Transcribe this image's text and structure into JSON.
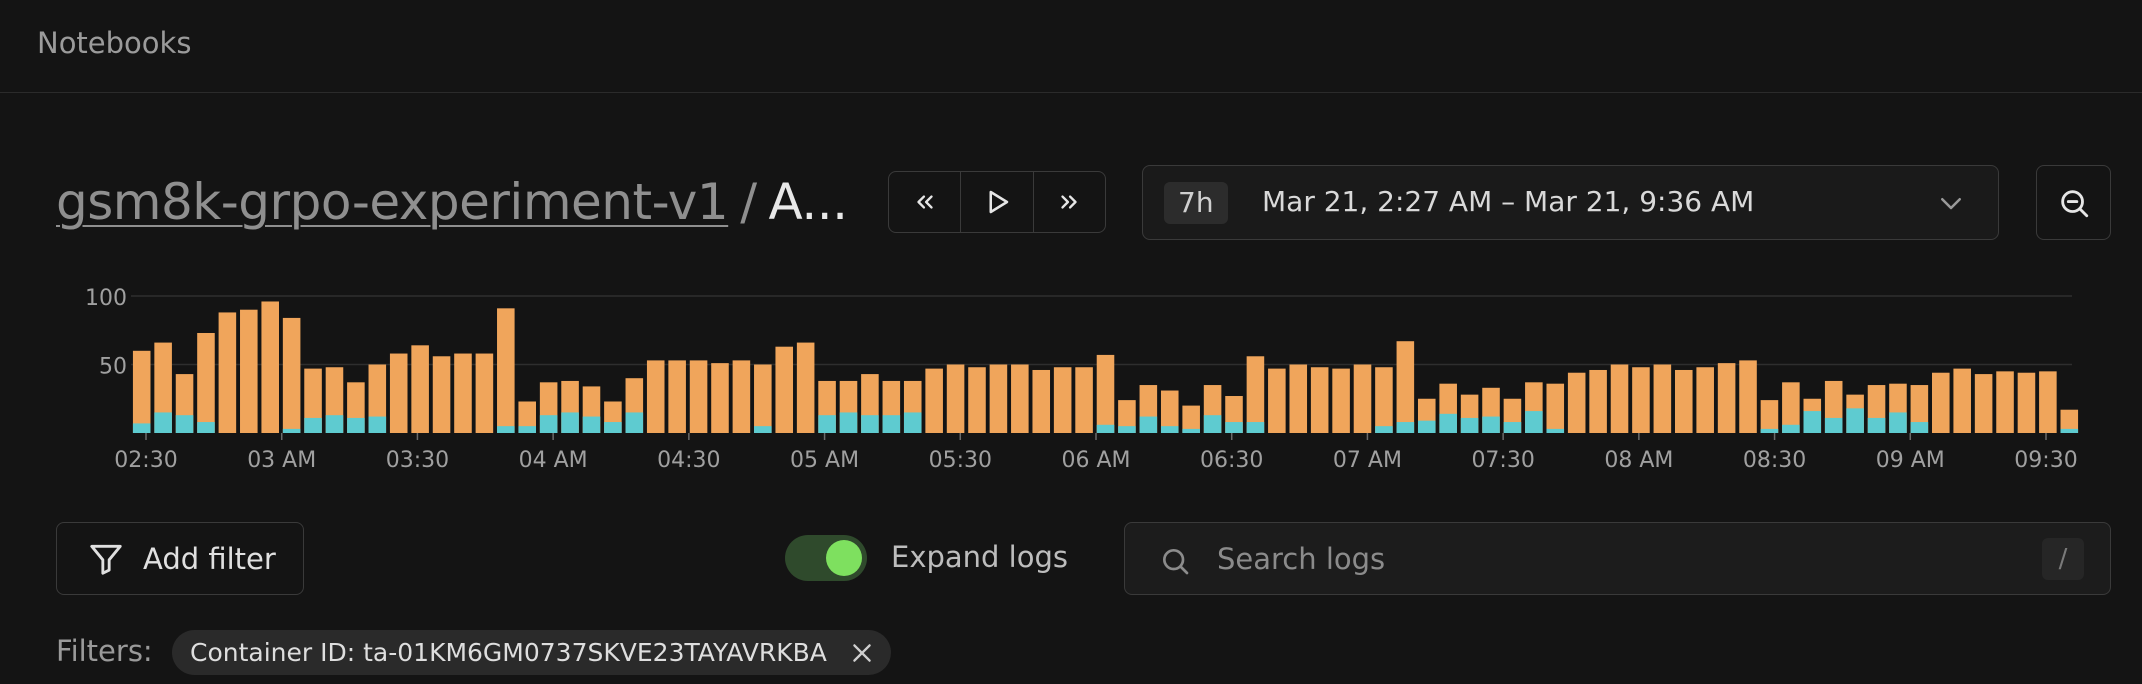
{
  "app": {
    "title": "Notebooks"
  },
  "breadcrumb": {
    "project": "gsm8k-grpo-experiment-v1",
    "separator": "/",
    "current": "A..."
  },
  "time_range": {
    "badge": "7h",
    "text": "Mar 21, 2:27 AM – Mar 21, 9:36 AM"
  },
  "colors": {
    "primary_bar": "#f0a55b",
    "secondary_bar": "#5ecbd0",
    "toggle_on": "#7ee05f"
  },
  "icons": {
    "rewind": "double-chevron-left-icon",
    "play": "play-icon",
    "forward": "double-chevron-right-icon",
    "dropdown": "chevron-down-icon",
    "zoom_out": "zoom-out-icon",
    "filter": "funnel-icon",
    "search": "search-icon",
    "remove": "close-icon"
  },
  "chart_data": {
    "type": "bar",
    "stacked": true,
    "ylim": [
      0,
      100
    ],
    "yticks": [
      100,
      50
    ],
    "grid": true,
    "xticks": [
      "02:30",
      "03 AM",
      "03:30",
      "04 AM",
      "04:30",
      "05 AM",
      "05:30",
      "06 AM",
      "06:30",
      "07 AM",
      "07:30",
      "08 AM",
      "08:30",
      "09 AM",
      "09:30"
    ],
    "series": [
      {
        "values": [
          60,
          66,
          43,
          73,
          88,
          90,
          96,
          84,
          47,
          48,
          37,
          50,
          58,
          64,
          56,
          58,
          58,
          91,
          23,
          37,
          38,
          34,
          23,
          40,
          53,
          53,
          53,
          51,
          53,
          50,
          63,
          66,
          38,
          38,
          43,
          38,
          38,
          47,
          50,
          48,
          50,
          50,
          46,
          48,
          48,
          57,
          24,
          35,
          31,
          20,
          35,
          27,
          56,
          47,
          50,
          48,
          47,
          50,
          48,
          67,
          25,
          36,
          28,
          33,
          25,
          37,
          36,
          44,
          46,
          50,
          48,
          50,
          46,
          48,
          51,
          53,
          24,
          37,
          25,
          38,
          28,
          35,
          36,
          35,
          44,
          47,
          43,
          45,
          44,
          45,
          17
        ]
      },
      {
        "values": [
          7,
          15,
          13,
          8,
          0,
          0,
          0,
          3,
          11,
          13,
          11,
          12,
          0,
          0,
          0,
          0,
          0,
          5,
          5,
          13,
          15,
          12,
          8,
          15,
          0,
          0,
          0,
          0,
          0,
          5,
          0,
          0,
          13,
          15,
          13,
          13,
          15,
          0,
          0,
          0,
          0,
          0,
          0,
          0,
          0,
          6,
          5,
          12,
          5,
          3,
          13,
          8,
          8,
          0,
          0,
          0,
          0,
          0,
          5,
          8,
          9,
          14,
          11,
          12,
          8,
          16,
          3,
          0,
          0,
          0,
          0,
          0,
          0,
          0,
          0,
          0,
          3,
          6,
          16,
          11,
          18,
          11,
          15,
          8,
          0,
          0,
          0,
          0,
          0,
          0,
          3
        ]
      }
    ]
  },
  "controls": {
    "add_filter": "Add filter",
    "expand_logs": "Expand logs",
    "expand_logs_on": true,
    "search_placeholder": "Search logs",
    "search_value": "",
    "shortcut": "/"
  },
  "filters": {
    "label": "Filters:",
    "chips": [
      {
        "text": "Container ID: ta-01KM6GM0737SKVE23TAYAVRKBA"
      }
    ]
  }
}
